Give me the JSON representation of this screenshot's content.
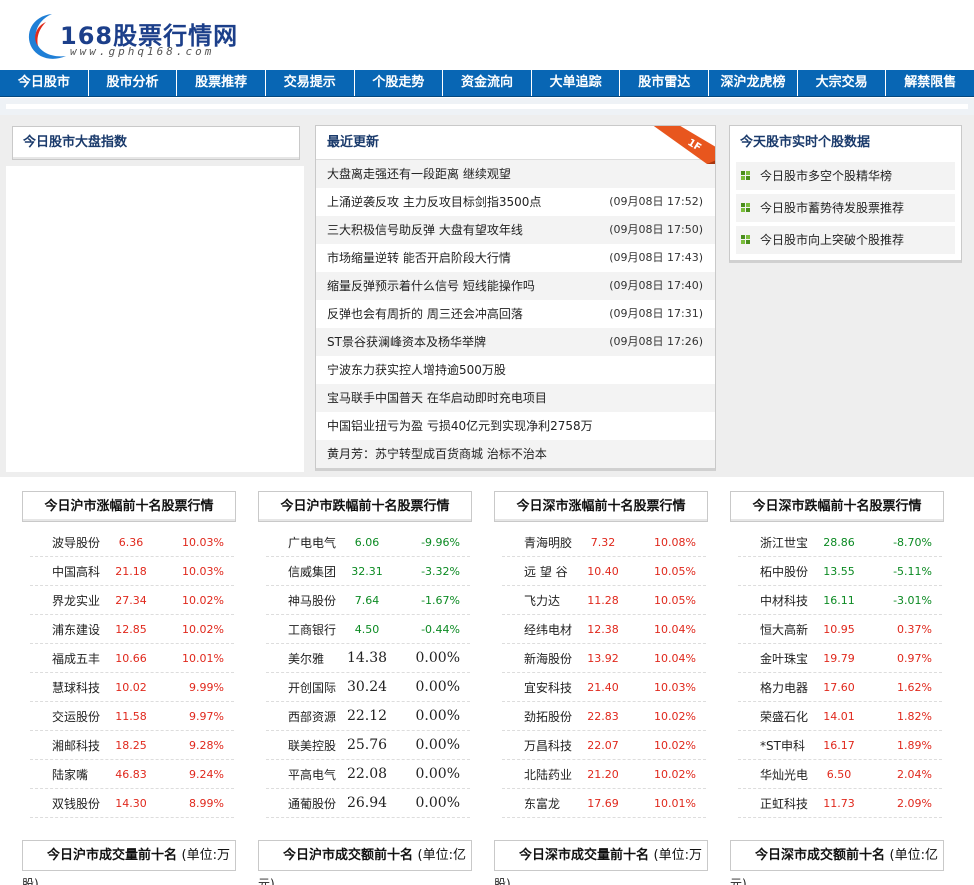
{
  "logo": {
    "title_num": "168",
    "title_text": "股票行情网",
    "url": "www.gphq168.com"
  },
  "nav": [
    "今日股市",
    "股市分析",
    "股票推荐",
    "交易提示",
    "个股走势",
    "资金流向",
    "大单追踪",
    "股市雷达",
    "深沪龙虎榜",
    "大宗交易",
    "解禁限售"
  ],
  "left_panel": {
    "title": "今日股市大盘指数"
  },
  "latest": {
    "title": "最近更新",
    "badge": "1F",
    "items": [
      {
        "title": "大盘离走强还有一段距离 继续观望",
        "time": ""
      },
      {
        "title": "上涌逆袭反攻 主力反攻目标剑指3500点",
        "time": "(09月08日 17:52)"
      },
      {
        "title": "三大积极信号助反弹 大盘有望攻年线",
        "time": "(09月08日 17:50)"
      },
      {
        "title": "市场缩量逆转 能否开启阶段大行情",
        "time": "(09月08日 17:43)"
      },
      {
        "title": "缩量反弹预示着什么信号 短线能操作吗",
        "time": "(09月08日 17:40)"
      },
      {
        "title": "反弹也会有周折的 周三还会冲高回落",
        "time": "(09月08日 17:31)"
      },
      {
        "title": "ST景谷获澜峰资本及杨华举牌",
        "time": "(09月08日 17:26)"
      },
      {
        "title": "宁波东力获实控人增持逾500万股",
        "time": ""
      },
      {
        "title": "宝马联手中国普天 在华启动即时充电项目",
        "time": ""
      },
      {
        "title": "中国铝业扭亏为盈 亏损40亿元到实现净利2758万",
        "time": ""
      },
      {
        "title": "黄月芳：苏宁转型成百货商城 治标不治本",
        "time": ""
      }
    ]
  },
  "realtime": {
    "title": "今天股市实时个股数据",
    "items": [
      "今日股市多空个股精华榜",
      "今日股市蓄势待发股票推荐",
      "今日股市向上突破个股推荐"
    ]
  },
  "ranks": [
    {
      "title": "今日沪市涨幅前十名股票行情",
      "rows": [
        [
          "波导股份",
          "6.36",
          "10.03%"
        ],
        [
          "中国高科",
          "21.18",
          "10.03%"
        ],
        [
          "界龙实业",
          "27.34",
          "10.02%"
        ],
        [
          "浦东建设",
          "12.85",
          "10.02%"
        ],
        [
          "福成五丰",
          "10.66",
          "10.01%"
        ],
        [
          "慧球科技",
          "10.02",
          "9.99%"
        ],
        [
          "交运股份",
          "11.58",
          "9.97%"
        ],
        [
          "湘邮科技",
          "18.25",
          "9.28%"
        ],
        [
          "陆家嘴",
          "46.83",
          "9.24%"
        ],
        [
          "双钱股份",
          "14.30",
          "8.99%"
        ]
      ]
    },
    {
      "title": "今日沪市跌幅前十名股票行情",
      "rows": [
        [
          "广电电气",
          "6.06",
          "-9.96%"
        ],
        [
          "信威集团",
          "32.31",
          "-3.32%"
        ],
        [
          "神马股份",
          "7.64",
          "-1.67%"
        ],
        [
          "工商银行",
          "4.50",
          "-0.44%"
        ],
        [
          "美尔雅",
          "14.38",
          "0.00%"
        ],
        [
          "开创国际",
          "30.24",
          "0.00%"
        ],
        [
          "西部资源",
          "22.12",
          "0.00%"
        ],
        [
          "联美控股",
          "25.76",
          "0.00%"
        ],
        [
          "平高电气",
          "22.08",
          "0.00%"
        ],
        [
          "通葡股份",
          "26.94",
          "0.00%"
        ]
      ]
    },
    {
      "title": "今日深市涨幅前十名股票行情",
      "rows": [
        [
          "青海明胶",
          "7.32",
          "10.08%"
        ],
        [
          "远 望 谷",
          "10.40",
          "10.05%"
        ],
        [
          "飞力达",
          "11.28",
          "10.05%"
        ],
        [
          "经纬电材",
          "12.38",
          "10.04%"
        ],
        [
          "新海股份",
          "13.92",
          "10.04%"
        ],
        [
          "宜安科技",
          "21.40",
          "10.03%"
        ],
        [
          "劲拓股份",
          "22.83",
          "10.02%"
        ],
        [
          "万昌科技",
          "22.07",
          "10.02%"
        ],
        [
          "北陆药业",
          "21.20",
          "10.02%"
        ],
        [
          "东富龙",
          "17.69",
          "10.01%"
        ]
      ]
    },
    {
      "title": "今日深市跌幅前十名股票行情",
      "rows": [
        [
          "浙江世宝",
          "28.86",
          "-8.70%"
        ],
        [
          "柘中股份",
          "13.55",
          "-5.11%"
        ],
        [
          "中材科技",
          "16.11",
          "-3.01%"
        ],
        [
          "恒大高新",
          "10.95",
          "0.37%"
        ],
        [
          "金叶珠宝",
          "19.79",
          "0.97%"
        ],
        [
          "格力电器",
          "17.60",
          "1.62%"
        ],
        [
          "荣盛石化",
          "14.01",
          "1.82%"
        ],
        [
          "*ST申科",
          "16.17",
          "1.89%"
        ],
        [
          "华灿光电",
          "6.50",
          "2.04%"
        ],
        [
          "正虹科技",
          "11.73",
          "2.09%"
        ]
      ]
    }
  ],
  "volumes": [
    {
      "title": "今日沪市成交量前十名",
      "unit": "(单位:万",
      "wrap": "股)"
    },
    {
      "title": "今日沪市成交额前十名",
      "unit": "(单位:亿",
      "wrap": "元)"
    },
    {
      "title": "今日深市成交量前十名",
      "unit": "(单位:万",
      "wrap": "股)"
    },
    {
      "title": "今日深市成交额前十名",
      "unit": "(单位:亿",
      "wrap": "元)"
    }
  ],
  "colors": {
    "nav_bg": "#0866b4",
    "up": "#e0281c",
    "down": "#0b8a22",
    "badge": "#e8561e"
  }
}
